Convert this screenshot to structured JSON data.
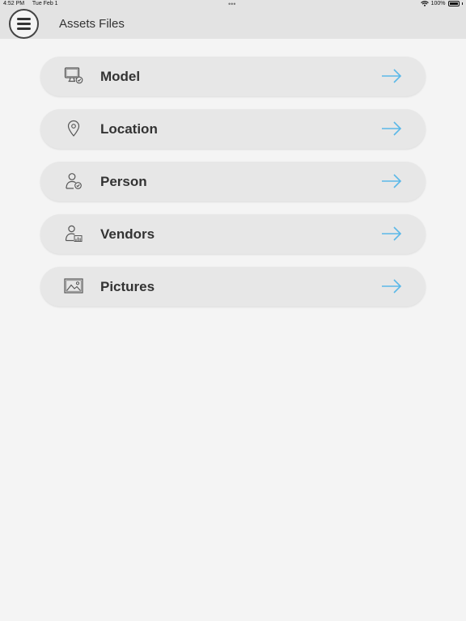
{
  "status_bar": {
    "time": "4:52 PM",
    "date": "Tue Feb 1",
    "battery": "100%"
  },
  "header": {
    "title": "Assets Files",
    "menu_icon": "hamburger-icon"
  },
  "colors": {
    "accent_arrow": "#5bb8e8",
    "item_background": "#e7e7e7",
    "page_background": "#f4f4f4"
  },
  "menu_items": [
    {
      "label": "Model",
      "icon": "monitor-check-icon"
    },
    {
      "label": "Location",
      "icon": "location-pin-icon"
    },
    {
      "label": "Person",
      "icon": "person-check-icon"
    },
    {
      "label": "Vendors",
      "icon": "person-chart-icon"
    },
    {
      "label": "Pictures",
      "icon": "picture-icon"
    }
  ]
}
